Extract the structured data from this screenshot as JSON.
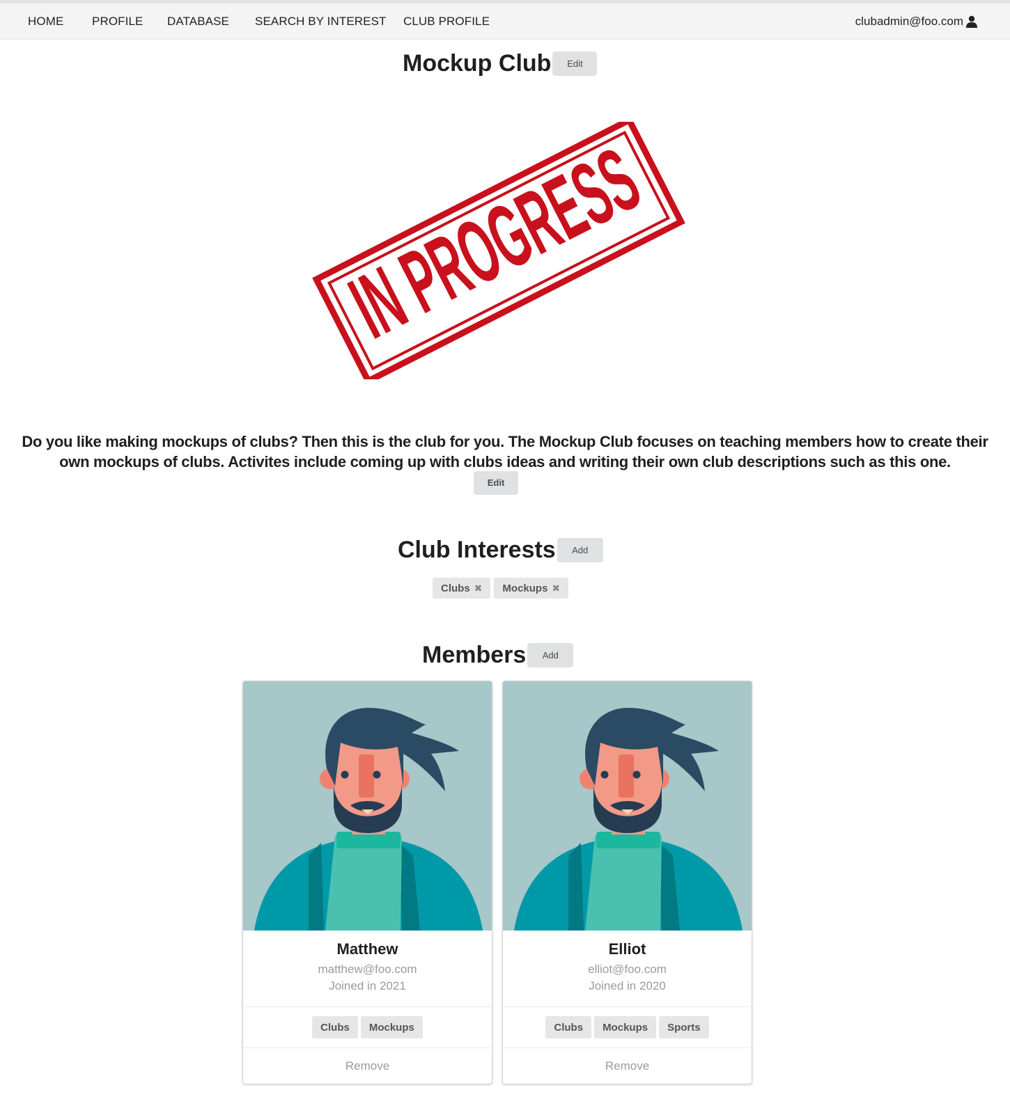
{
  "nav": {
    "items": [
      "HOME",
      "PROFILE",
      "DATABASE",
      "SEARCH BY INTEREST",
      "CLUB PROFILE"
    ],
    "user_email": "clubadmin@foo.com",
    "user_icon": "user-icon"
  },
  "club": {
    "name": "Mockup Club",
    "edit_label": "Edit",
    "image_text": "IN PROGRESS",
    "image_color": "#c8111c",
    "description": "Do you like making mockups of clubs? Then this is the club for you. The Mockup Club focuses on teaching members how to create their own mockups of clubs. Activites include coming up with clubs ideas and writing their own club descriptions such as this one.",
    "description_edit_label": "Edit"
  },
  "interests": {
    "title": "Club Interests",
    "add_label": "Add",
    "tags": [
      "Clubs",
      "Mockups"
    ],
    "remove_icon": "✖"
  },
  "members": {
    "title": "Members",
    "add_label": "Add",
    "list": [
      {
        "name": "Matthew",
        "email": "matthew@foo.com",
        "joined": "Joined in 2021",
        "tags": [
          "Clubs",
          "Mockups"
        ],
        "remove_label": "Remove"
      },
      {
        "name": "Elliot",
        "email": "elliot@foo.com",
        "joined": "Joined in 2020",
        "tags": [
          "Clubs",
          "Mockups",
          "Sports"
        ],
        "remove_label": "Remove"
      }
    ]
  }
}
